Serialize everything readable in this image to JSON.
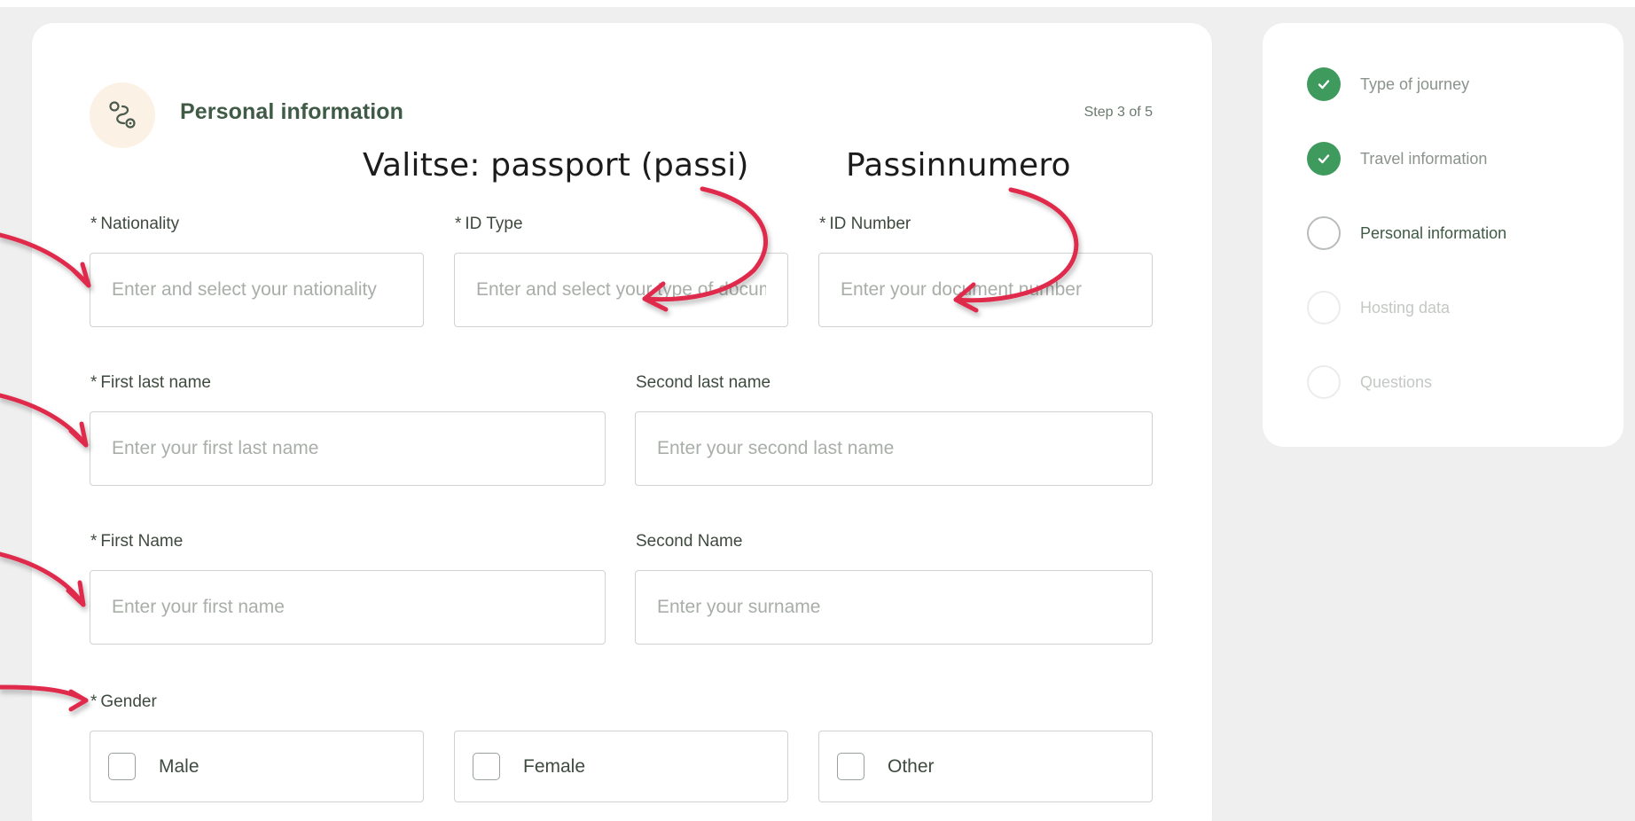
{
  "form": {
    "section_title": "Personal information",
    "step_text": "Step 3 of 5",
    "section_icon": "route-icon",
    "required_mark": "*",
    "nationality": {
      "label": "Nationality",
      "placeholder": "Enter and select your nationality",
      "required": true
    },
    "id_type": {
      "label": "ID Type",
      "placeholder": "Enter and select your type of document",
      "required": true
    },
    "id_number": {
      "label": "ID Number",
      "placeholder": "Enter your document number",
      "required": true
    },
    "first_last_name": {
      "label": "First last name",
      "placeholder": "Enter your first last name",
      "required": true
    },
    "second_last_name": {
      "label": "Second last name",
      "placeholder": "Enter your second last name",
      "required": false
    },
    "first_name": {
      "label": "First Name",
      "placeholder": "Enter your first name",
      "required": true
    },
    "second_name": {
      "label": "Second Name",
      "placeholder": "Enter your surname",
      "required": false
    },
    "gender": {
      "label": "Gender",
      "required": true,
      "options": [
        "Male",
        "Female",
        "Other"
      ]
    }
  },
  "annotations": {
    "id_type_note": "Valitse: passport (passi)",
    "id_number_note": "Passinnumero",
    "arrow_color": "#e0294b"
  },
  "steps": {
    "items": [
      {
        "label": "Type of journey",
        "state": "done"
      },
      {
        "label": "Travel information",
        "state": "done"
      },
      {
        "label": "Personal information",
        "state": "current"
      },
      {
        "label": "Hosting data",
        "state": "future"
      },
      {
        "label": "Questions",
        "state": "future"
      }
    ],
    "done_color": "#3f9a5e"
  }
}
